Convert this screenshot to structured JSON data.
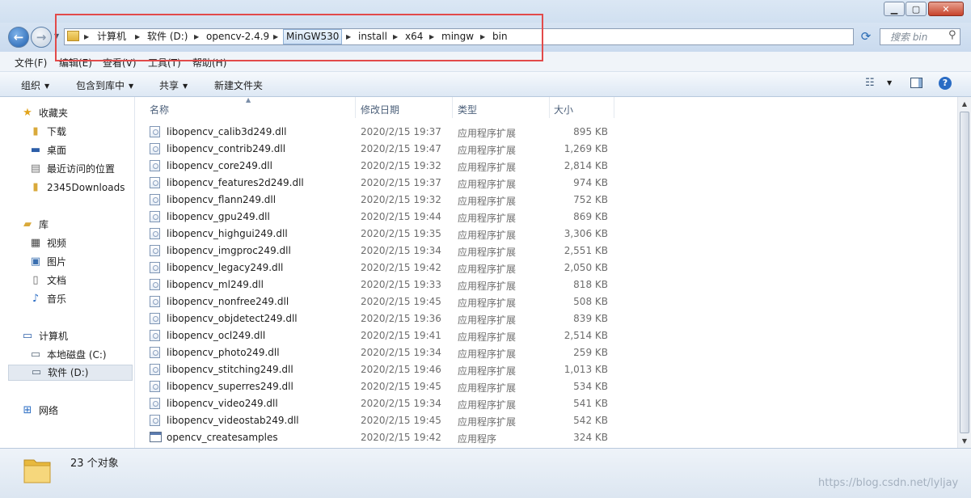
{
  "address": {
    "crumbs": [
      "计算机",
      "软件 (D:)",
      "opencv-2.4.9",
      "MinGW530",
      "install",
      "x64",
      "mingw",
      "bin"
    ]
  },
  "search": {
    "placeholder": "搜索 bin"
  },
  "menubar": [
    "文件(F)",
    "编辑(E)",
    "查看(V)",
    "工具(T)",
    "帮助(H)"
  ],
  "toolbar": {
    "organize": "组织",
    "include": "包含到库中",
    "share": "共享",
    "new_folder": "新建文件夹"
  },
  "nav": {
    "favorites": {
      "label": "收藏夹",
      "items": [
        "下载",
        "桌面",
        "最近访问的位置",
        "2345Downloads"
      ]
    },
    "libraries": {
      "label": "库",
      "items": [
        "视频",
        "图片",
        "文档",
        "音乐"
      ]
    },
    "computer": {
      "label": "计算机",
      "items": [
        "本地磁盘 (C:)",
        "软件 (D:)"
      ]
    },
    "network": {
      "label": "网络"
    }
  },
  "columns": {
    "name": "名称",
    "date": "修改日期",
    "type": "类型",
    "size": "大小"
  },
  "files": [
    {
      "name": "libopencv_calib3d249.dll",
      "date": "2020/2/15 19:37",
      "type": "应用程序扩展",
      "size": "895 KB",
      "icon": "dll-icon"
    },
    {
      "name": "libopencv_contrib249.dll",
      "date": "2020/2/15 19:47",
      "type": "应用程序扩展",
      "size": "1,269 KB",
      "icon": "dll-icon"
    },
    {
      "name": "libopencv_core249.dll",
      "date": "2020/2/15 19:32",
      "type": "应用程序扩展",
      "size": "2,814 KB",
      "icon": "dll-icon"
    },
    {
      "name": "libopencv_features2d249.dll",
      "date": "2020/2/15 19:37",
      "type": "应用程序扩展",
      "size": "974 KB",
      "icon": "dll-icon"
    },
    {
      "name": "libopencv_flann249.dll",
      "date": "2020/2/15 19:32",
      "type": "应用程序扩展",
      "size": "752 KB",
      "icon": "dll-icon"
    },
    {
      "name": "libopencv_gpu249.dll",
      "date": "2020/2/15 19:44",
      "type": "应用程序扩展",
      "size": "869 KB",
      "icon": "dll-icon"
    },
    {
      "name": "libopencv_highgui249.dll",
      "date": "2020/2/15 19:35",
      "type": "应用程序扩展",
      "size": "3,306 KB",
      "icon": "dll-icon"
    },
    {
      "name": "libopencv_imgproc249.dll",
      "date": "2020/2/15 19:34",
      "type": "应用程序扩展",
      "size": "2,551 KB",
      "icon": "dll-icon"
    },
    {
      "name": "libopencv_legacy249.dll",
      "date": "2020/2/15 19:42",
      "type": "应用程序扩展",
      "size": "2,050 KB",
      "icon": "dll-icon"
    },
    {
      "name": "libopencv_ml249.dll",
      "date": "2020/2/15 19:33",
      "type": "应用程序扩展",
      "size": "818 KB",
      "icon": "dll-icon"
    },
    {
      "name": "libopencv_nonfree249.dll",
      "date": "2020/2/15 19:45",
      "type": "应用程序扩展",
      "size": "508 KB",
      "icon": "dll-icon"
    },
    {
      "name": "libopencv_objdetect249.dll",
      "date": "2020/2/15 19:36",
      "type": "应用程序扩展",
      "size": "839 KB",
      "icon": "dll-icon"
    },
    {
      "name": "libopencv_ocl249.dll",
      "date": "2020/2/15 19:41",
      "type": "应用程序扩展",
      "size": "2,514 KB",
      "icon": "dll-icon"
    },
    {
      "name": "libopencv_photo249.dll",
      "date": "2020/2/15 19:34",
      "type": "应用程序扩展",
      "size": "259 KB",
      "icon": "dll-icon"
    },
    {
      "name": "libopencv_stitching249.dll",
      "date": "2020/2/15 19:46",
      "type": "应用程序扩展",
      "size": "1,013 KB",
      "icon": "dll-icon"
    },
    {
      "name": "libopencv_superres249.dll",
      "date": "2020/2/15 19:45",
      "type": "应用程序扩展",
      "size": "534 KB",
      "icon": "dll-icon"
    },
    {
      "name": "libopencv_video249.dll",
      "date": "2020/2/15 19:34",
      "type": "应用程序扩展",
      "size": "541 KB",
      "icon": "dll-icon"
    },
    {
      "name": "libopencv_videostab249.dll",
      "date": "2020/2/15 19:45",
      "type": "应用程序扩展",
      "size": "542 KB",
      "icon": "dll-icon"
    },
    {
      "name": "opencv_createsamples",
      "date": "2020/2/15 19:42",
      "type": "应用程序",
      "size": "324 KB",
      "icon": "exe-icon"
    }
  ],
  "status": {
    "count": "23 个对象"
  },
  "watermark": "https://blog.csdn.net/lyljay",
  "colors": {
    "highlight_box": "#e24a4a",
    "window_frame": "#dfe9f5"
  }
}
